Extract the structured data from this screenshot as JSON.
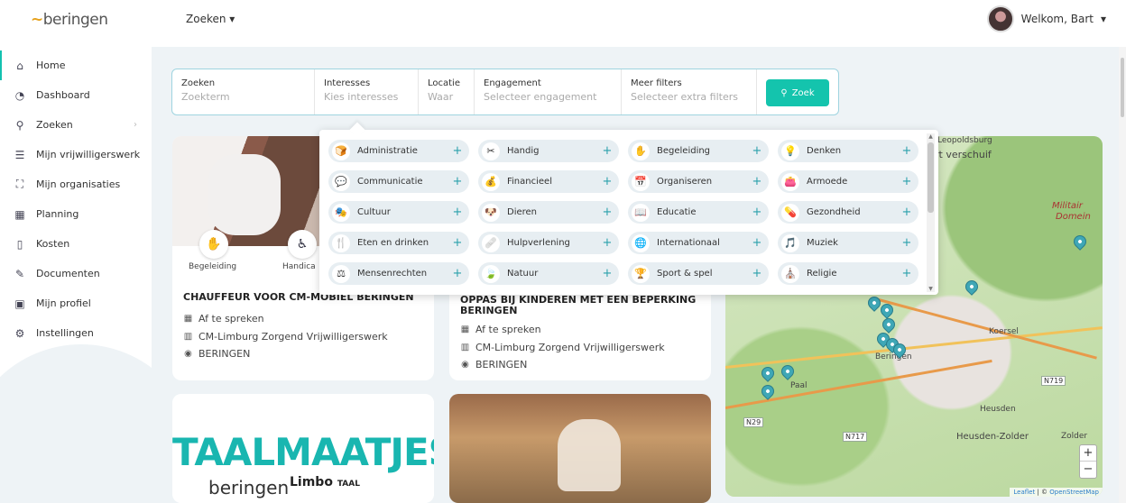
{
  "header": {
    "logo": "beringen",
    "search_menu": "Zoeken",
    "welcome": "Welkom, Bart"
  },
  "sidebar": {
    "items": [
      {
        "label": "Home",
        "icon": "home-icon"
      },
      {
        "label": "Dashboard",
        "icon": "dashboard-icon"
      },
      {
        "label": "Zoeken",
        "icon": "search-icon"
      },
      {
        "label": "Mijn vrijwilligerswerk",
        "icon": "list-icon"
      },
      {
        "label": "Mijn organisaties",
        "icon": "organisation-icon"
      },
      {
        "label": "Planning",
        "icon": "calendar-icon"
      },
      {
        "label": "Kosten",
        "icon": "receipt-icon"
      },
      {
        "label": "Documenten",
        "icon": "document-icon"
      },
      {
        "label": "Mijn profiel",
        "icon": "profile-icon"
      },
      {
        "label": "Instellingen",
        "icon": "settings-icon"
      }
    ]
  },
  "search": {
    "fields": [
      {
        "label": "Zoeken",
        "placeholder": "Zoekterm"
      },
      {
        "label": "Interesses",
        "placeholder": "Kies interesses"
      },
      {
        "label": "Locatie",
        "placeholder": "Waar"
      },
      {
        "label": "Engagement",
        "placeholder": "Selecteer engagement"
      },
      {
        "label": "Meer filters",
        "placeholder": "Selecteer extra filters"
      }
    ],
    "button": "Zoek"
  },
  "interests": [
    {
      "label": "Administratie",
      "icon": "🍞"
    },
    {
      "label": "Handig",
      "icon": "✂"
    },
    {
      "label": "Begeleiding",
      "icon": "✋"
    },
    {
      "label": "Denken",
      "icon": "💡"
    },
    {
      "label": "Communicatie",
      "icon": "💬"
    },
    {
      "label": "Financieel",
      "icon": "💰"
    },
    {
      "label": "Organiseren",
      "icon": "📅"
    },
    {
      "label": "Armoede",
      "icon": "👛"
    },
    {
      "label": "Cultuur",
      "icon": "🎭"
    },
    {
      "label": "Dieren",
      "icon": "🐶"
    },
    {
      "label": "Educatie",
      "icon": "📖"
    },
    {
      "label": "Gezondheid",
      "icon": "💊"
    },
    {
      "label": "Eten en drinken",
      "icon": "🍴"
    },
    {
      "label": "Hulpverlening",
      "icon": "🩹"
    },
    {
      "label": "Internationaal",
      "icon": "🌐"
    },
    {
      "label": "Muziek",
      "icon": "🎵"
    },
    {
      "label": "Mensenrechten",
      "icon": "⚖"
    },
    {
      "label": "Natuur",
      "icon": "🍃"
    },
    {
      "label": "Sport & spel",
      "icon": "🏆"
    },
    {
      "label": "Religie",
      "icon": "⛪"
    }
  ],
  "cards": [
    {
      "title": "CHAUFFEUR VOOR CM-MOBIEL BERINGEN",
      "tags": [
        "Begeleiding",
        "Handica"
      ],
      "when": "Af te spreken",
      "org": "CM-Limburg Zorgend Vrijwilligerswerk",
      "place": "BERINGEN"
    },
    {
      "title_line1": "OPPAS BIJ KINDEREN MET EEN BEPERKING",
      "title_line2": "BERINGEN",
      "when": "Af te spreken",
      "org": "CM-Limburg Zorgend Vrijwilligerswerk",
      "place": "BERINGEN"
    },
    {
      "brand": "TAALMAATJES",
      "sub": "beringen",
      "partner": "Limbo",
      "partner_sub": "TAAL"
    }
  ],
  "map": {
    "labels": {
      "top": "Leopoldsburg",
      "shift": "rt verschuif",
      "militair": "Militair",
      "domein": "Domein",
      "beringen": "Beringen",
      "koersel": "Koersel",
      "heusden": "Heusden",
      "heusden_zolder": "Heusden-Zolder",
      "zolder": "Zolder",
      "paal": "Paal"
    },
    "roads": [
      "N29",
      "N717",
      "N719"
    ],
    "zoom_in": "+",
    "zoom_out": "−",
    "attribution_leaflet": "Leaflet",
    "attribution_sep": " | © ",
    "attribution_osm": "OpenStreetMap"
  },
  "colors": {
    "accent": "#14c4ad",
    "pin": "#3fa7b6",
    "logo_accent": "#e6a11b"
  }
}
